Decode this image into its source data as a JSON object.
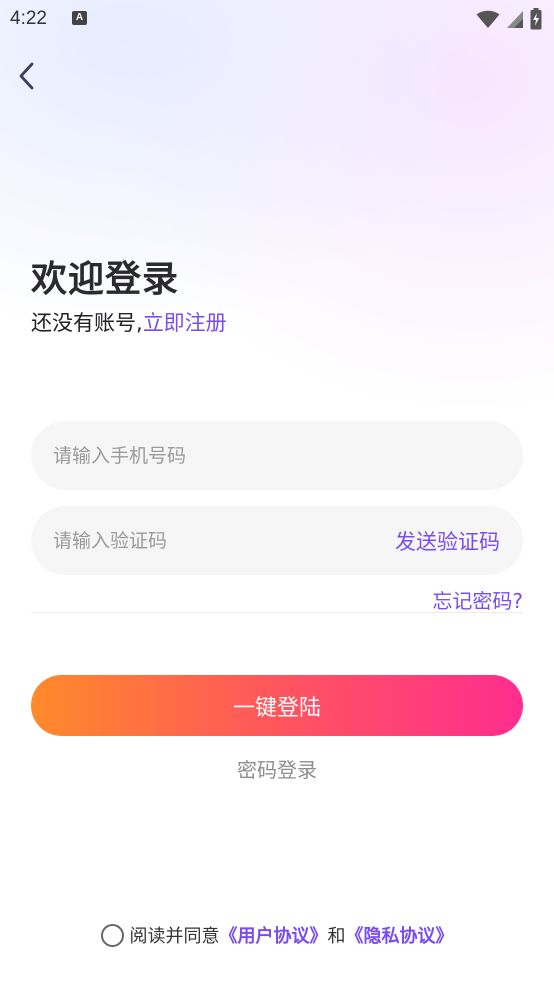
{
  "status_bar": {
    "time": "4:22",
    "notification_icon_letter": "A",
    "icons": [
      "wifi-icon",
      "signal-icon",
      "battery-charging-icon"
    ]
  },
  "header": {
    "back_icon": "chevron-left-icon"
  },
  "welcome": {
    "title": "欢迎登录",
    "no_account_text": "还没有账号,",
    "register_link": "立即注册"
  },
  "form": {
    "phone_placeholder": "请输入手机号码",
    "code_placeholder": "请输入验证码",
    "send_code_label": "发送验证码",
    "forgot_password_label": "忘记密码?"
  },
  "actions": {
    "one_click_login_label": "一键登陆",
    "password_login_label": "密码登录"
  },
  "agreement": {
    "prefix": "阅读并同意",
    "user_agreement": "《用户协议》",
    "and": "和",
    "privacy_policy": "《隐私协议》",
    "checked": false
  },
  "colors": {
    "accent": "#7a4cf0",
    "button_gradient_start": "#ff8a2a",
    "button_gradient_end": "#ff2d8f",
    "input_background": "#f6f6f6"
  }
}
